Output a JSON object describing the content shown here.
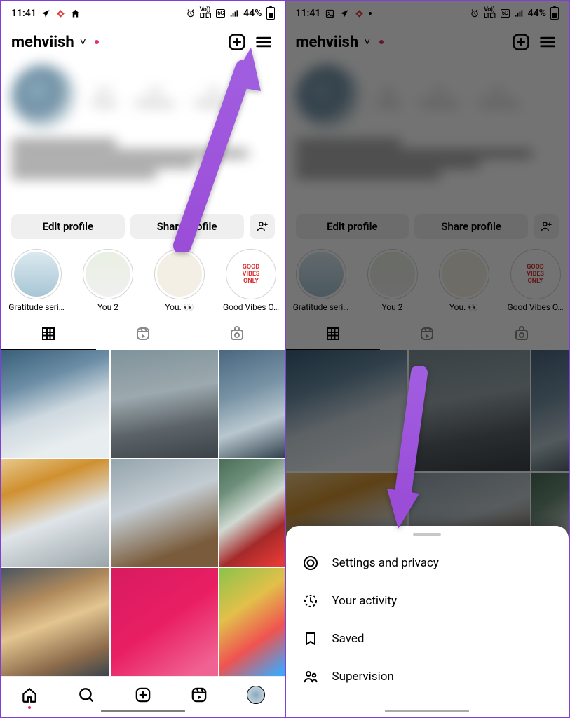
{
  "status": {
    "time": "11:41",
    "net_label_top": "Vo))",
    "net_label_bottom": "LTE1",
    "net_type": "5G",
    "battery_pct": "44%"
  },
  "header": {
    "username": "mehviish",
    "chevron": "˅"
  },
  "actions": {
    "edit_label": "Edit profile",
    "share_label": "Share profile"
  },
  "highlights": [
    {
      "label": "Gratitude seri…"
    },
    {
      "label": "You 2"
    },
    {
      "label": "You. 👀"
    },
    {
      "label": "Good Vibes O…"
    }
  ],
  "sheet": {
    "items": [
      {
        "icon": "gear",
        "label": "Settings and privacy"
      },
      {
        "icon": "activity",
        "label": "Your activity"
      },
      {
        "icon": "bookmark",
        "label": "Saved"
      },
      {
        "icon": "supervision",
        "label": "Supervision"
      }
    ]
  }
}
